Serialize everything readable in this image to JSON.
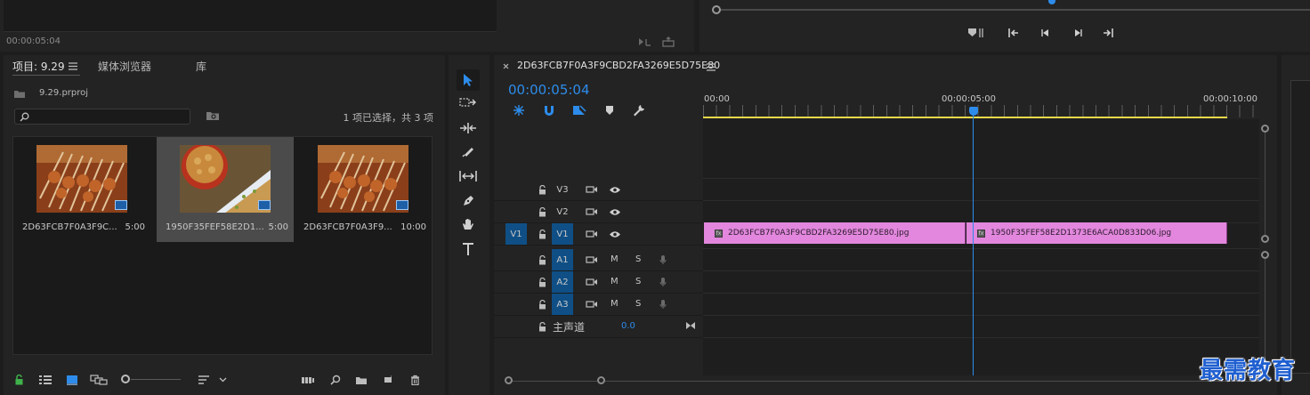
{
  "source_monitor": {
    "timecode": "00:00:05:04"
  },
  "project_panel": {
    "tabs": [
      {
        "label": "项目: 9.29"
      },
      {
        "label": "媒体浏览器"
      },
      {
        "label": "库"
      }
    ],
    "project_file": "9.29.prproj",
    "search_placeholder": "",
    "selection_status": "1 项已选择，共 3 项",
    "items": [
      {
        "name": "2D63FCB7F0A3F9C...",
        "duration": "5:00",
        "selected": false
      },
      {
        "name": "1950F35FEF58E2D1...",
        "duration": "5:00",
        "selected": true
      },
      {
        "name": "2D63FCB7F0A3F9...",
        "duration": "10:00",
        "selected": false
      }
    ]
  },
  "timeline": {
    "sequence_name": "2D63FCB7F0A3F9CBD2FA3269E5D75E80",
    "timecode": "00:00:05:04",
    "ruler": [
      "00:00",
      "00:00:05:00",
      "00:00:10:00"
    ],
    "video_tracks": [
      {
        "label": "V3"
      },
      {
        "label": "V2"
      },
      {
        "label": "V1",
        "source": "V1"
      }
    ],
    "audio_tracks": [
      {
        "label": "A1",
        "m": "M",
        "s": "S"
      },
      {
        "label": "A2",
        "m": "M",
        "s": "S"
      },
      {
        "label": "A3",
        "m": "M",
        "s": "S"
      }
    ],
    "master": {
      "label": "主声道",
      "value": "0.0"
    },
    "clips": [
      {
        "name": "2D63FCB7F0A3F9CBD2FA3269E5D75E80.jpg"
      },
      {
        "name": "1950F35FEF58E2D1373E6ACA0D833D06.jpg"
      }
    ]
  },
  "watermark": "最需教育",
  "colors": {
    "accent": "#2d8ceb",
    "clip": "#e287dd",
    "work_area": "#e8d84a",
    "track_blue": "#0f4f86"
  }
}
